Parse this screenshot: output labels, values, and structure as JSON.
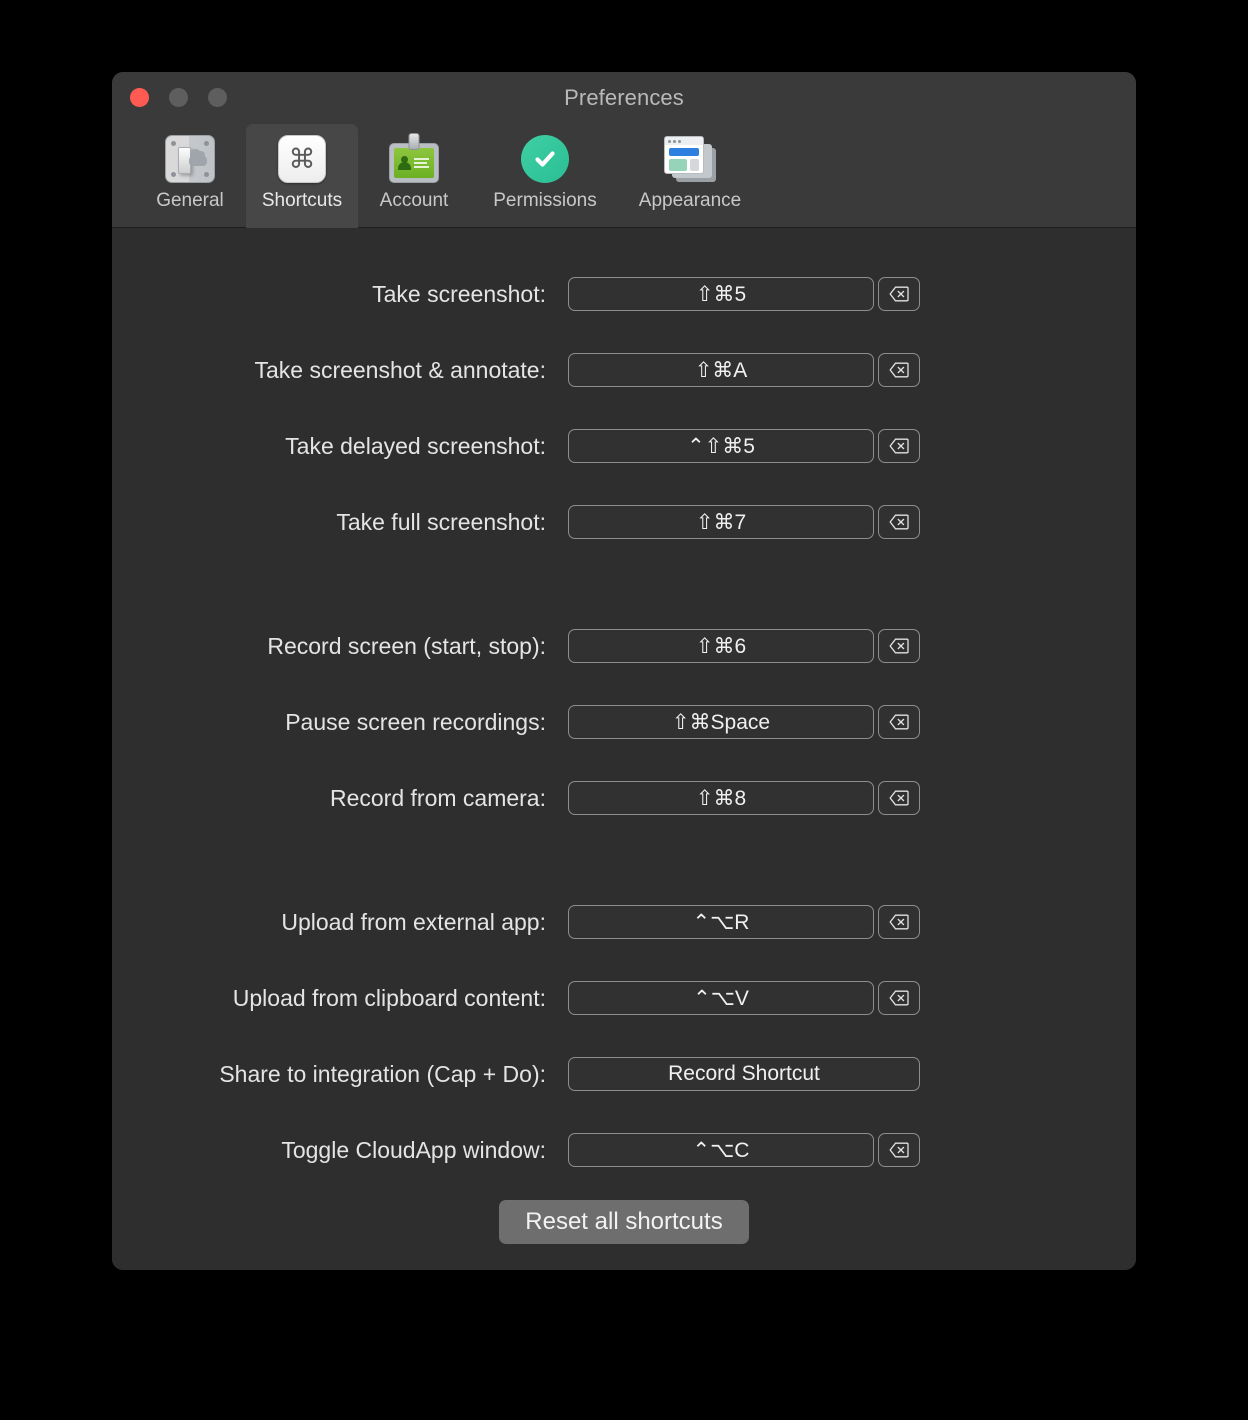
{
  "window": {
    "title": "Preferences",
    "traffic_lights": [
      "close",
      "minimize",
      "maximize"
    ]
  },
  "toolbar": {
    "tabs": [
      {
        "label": "General",
        "icon": "switch-cloud-icon",
        "selected": false
      },
      {
        "label": "Shortcuts",
        "icon": "command-key-icon",
        "selected": true
      },
      {
        "label": "Account",
        "icon": "id-badge-icon",
        "selected": false
      },
      {
        "label": "Permissions",
        "icon": "check-circle-icon",
        "selected": false
      },
      {
        "label": "Appearance",
        "icon": "windows-stack-icon",
        "selected": false
      }
    ]
  },
  "shortcuts": {
    "groups": [
      {
        "rows": [
          {
            "label": "Take screenshot:",
            "value": "⇧⌘5",
            "has_clear": true
          },
          {
            "label": "Take screenshot & annotate:",
            "value": "⇧⌘A",
            "has_clear": true
          },
          {
            "label": "Take delayed screenshot:",
            "value": "⌃⇧⌘5",
            "has_clear": true
          },
          {
            "label": "Take full screenshot:",
            "value": "⇧⌘7",
            "has_clear": true
          }
        ]
      },
      {
        "rows": [
          {
            "label": "Record screen (start, stop):",
            "value": "⇧⌘6",
            "has_clear": true
          },
          {
            "label": "Pause screen recordings:",
            "value": "⇧⌘Space",
            "has_clear": true
          },
          {
            "label": "Record from camera:",
            "value": "⇧⌘8",
            "has_clear": true
          }
        ]
      },
      {
        "rows": [
          {
            "label": "Upload from external app:",
            "value": "⌃⌥R",
            "has_clear": true
          },
          {
            "label": "Upload from clipboard content:",
            "value": "⌃⌥V",
            "has_clear": true
          },
          {
            "label": "Share to integration (Cap + Do):",
            "value": "Record Shortcut",
            "has_clear": false
          },
          {
            "label": "Toggle CloudApp window:",
            "value": "⌃⌥C",
            "has_clear": true
          }
        ]
      }
    ],
    "clear_icon": "delete-left-icon",
    "reset_label": "Reset all shortcuts"
  },
  "colors": {
    "window_bg": "#2e2e2e",
    "titlebar_bg": "#3a3a3a",
    "tab_selected_bg": "#474747",
    "field_border": "#8d8d8d",
    "field_bg": "#313131",
    "accent_green": "#2bbd94",
    "close_red": "#ff5b52",
    "reset_btn_bg": "#6e6e6e"
  }
}
